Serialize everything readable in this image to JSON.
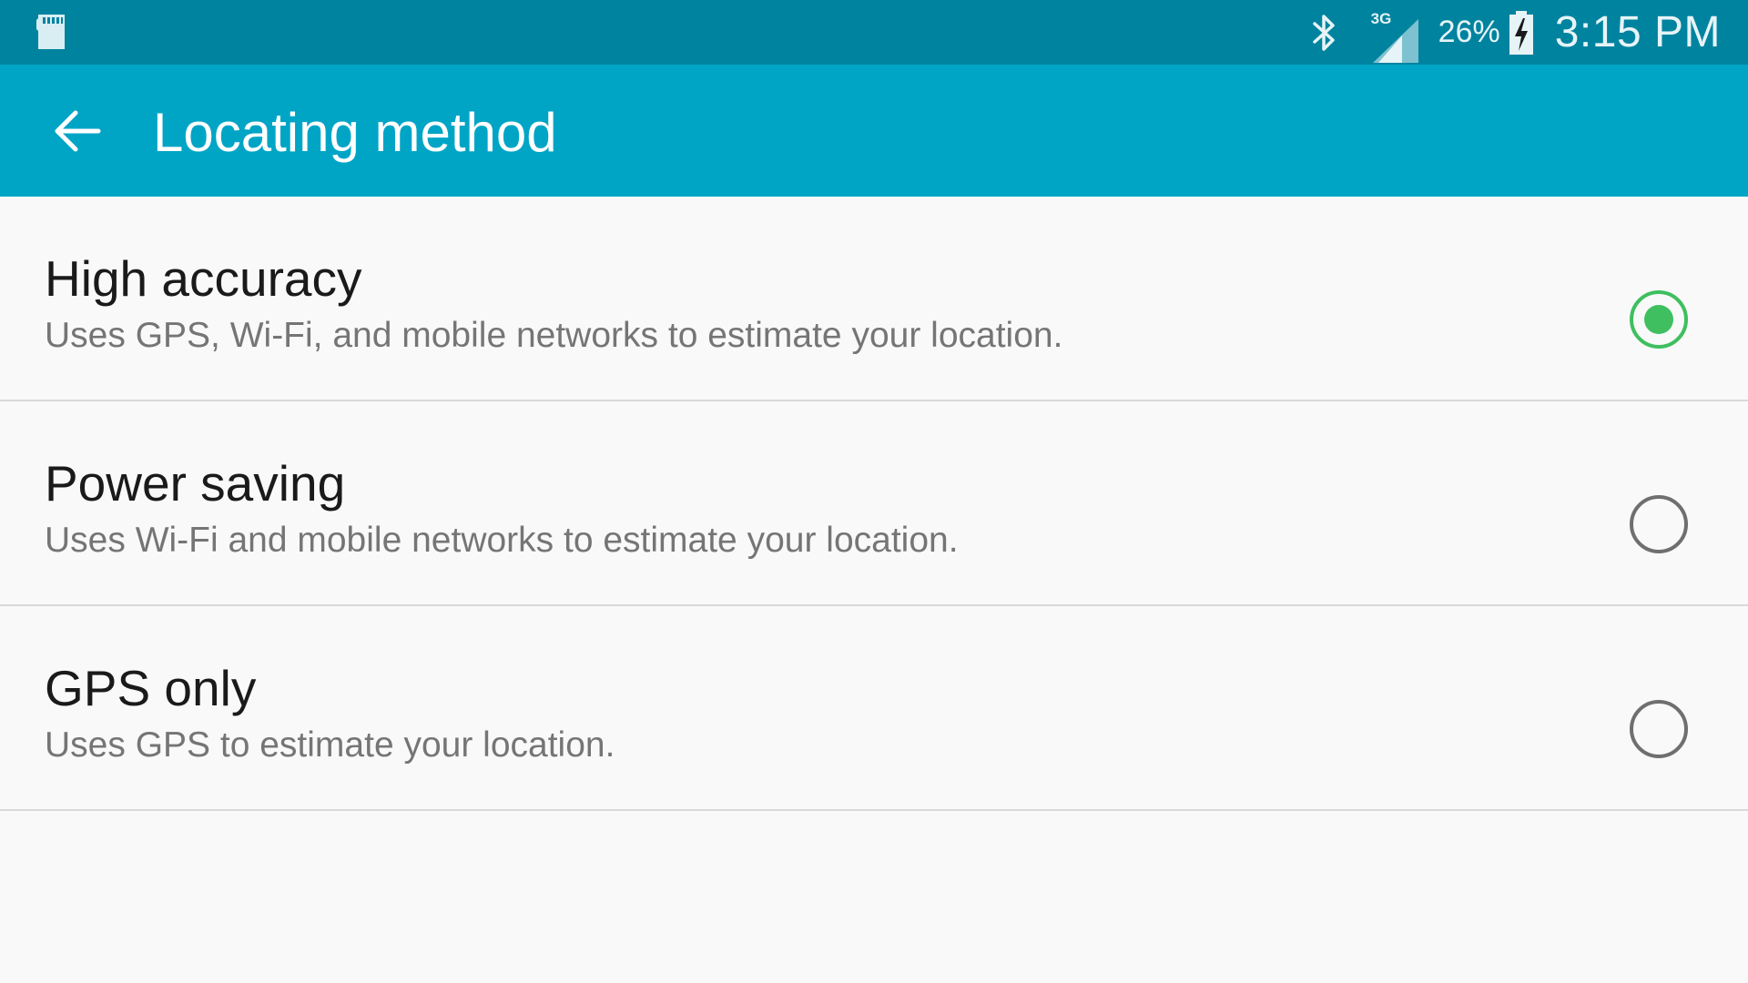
{
  "status_bar": {
    "sd_card_icon": "sd-card-icon",
    "bluetooth_icon": "bluetooth-icon",
    "network_type": "3G",
    "signal_icon": "signal-icon",
    "battery_percent": "26%",
    "battery_icon": "battery-charging-icon",
    "time": "3:15 PM",
    "background_color": "#00839f"
  },
  "app_bar": {
    "back_icon": "arrow-back-icon",
    "title": "Locating method",
    "background_color": "#00a5c6"
  },
  "options": [
    {
      "title": "High accuracy",
      "description": "Uses GPS, Wi-Fi, and mobile networks to estimate your location.",
      "selected": true
    },
    {
      "title": "Power saving",
      "description": "Uses Wi-Fi and mobile networks to estimate your location.",
      "selected": false
    },
    {
      "title": "GPS only",
      "description": "Uses GPS to estimate your location.",
      "selected": false
    }
  ],
  "colors": {
    "radio_selected": "#3fbf5f",
    "radio_unselected": "#6f6f6f"
  }
}
